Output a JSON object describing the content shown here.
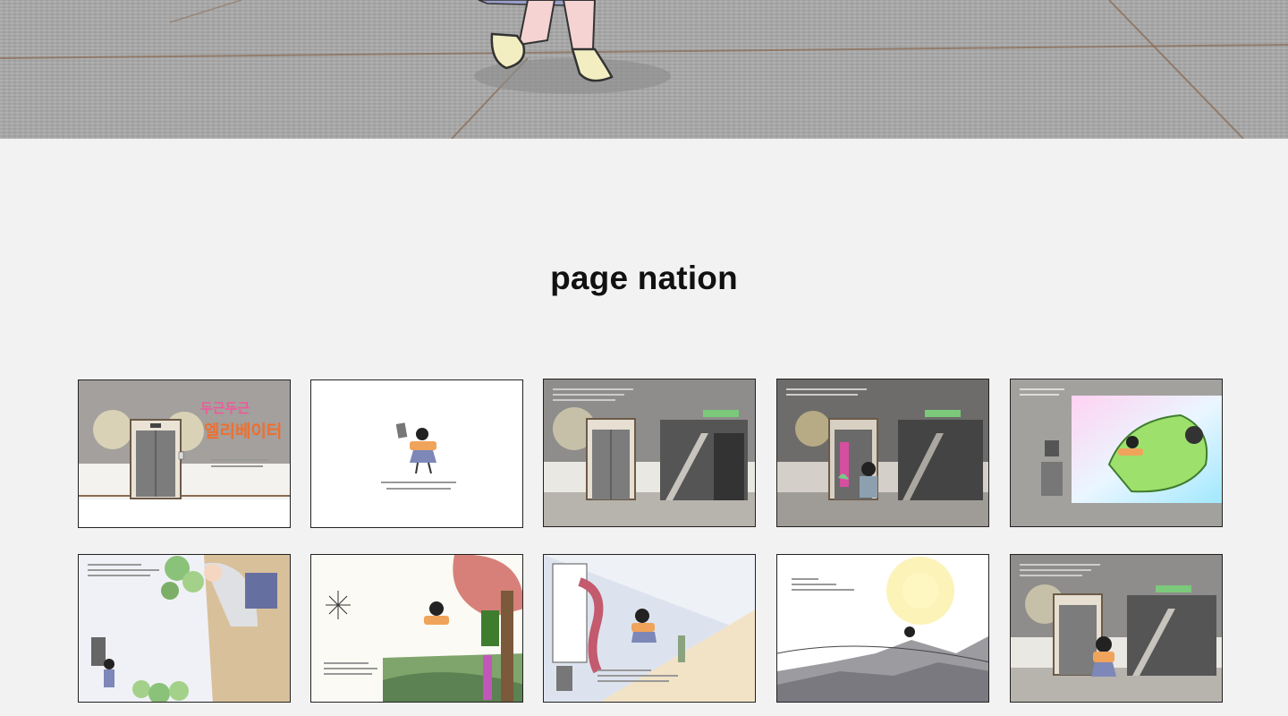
{
  "section": {
    "title": "page nation"
  },
  "cover": {
    "title_line1": "두근두근",
    "title_line2": "엘리베이터"
  },
  "colors": {
    "background": "#f2f2f2",
    "hero_pavement": "#a9a9a9",
    "title_text": "#111111",
    "thumb_border": "#222222"
  },
  "pages": [
    {
      "id": 1,
      "name": "cover"
    },
    {
      "id": 2,
      "name": "girl-on-white"
    },
    {
      "id": 3,
      "name": "elevator-lobby"
    },
    {
      "id": 4,
      "name": "girl-at-elevator"
    },
    {
      "id": 5,
      "name": "flying-with-monster"
    },
    {
      "id": 6,
      "name": "giant-in-elevator"
    },
    {
      "id": 7,
      "name": "spider-web-tree"
    },
    {
      "id": 8,
      "name": "tentacle-sky"
    },
    {
      "id": 9,
      "name": "rooftop-sun"
    },
    {
      "id": 10,
      "name": "girl-back-at-lobby"
    }
  ]
}
